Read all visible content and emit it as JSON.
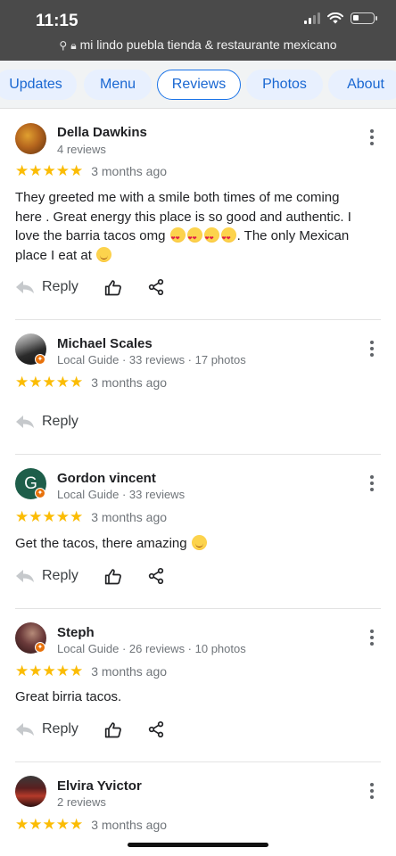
{
  "status_bar": {
    "time": "11:15"
  },
  "url_bar": {
    "text": "mi lindo puebla tienda & restaurante mexicano"
  },
  "tabs": [
    {
      "label": "Updates",
      "active": false
    },
    {
      "label": "Menu",
      "active": false
    },
    {
      "label": "Reviews",
      "active": true
    },
    {
      "label": "Photos",
      "active": false
    },
    {
      "label": "About",
      "active": false
    }
  ],
  "reviews": [
    {
      "name": "Della Dawkins",
      "meta": "4 reviews",
      "rating": 5,
      "stars": "★★★★★",
      "time_ago": "3 months ago",
      "text_lines": [
        "They greeted me with a smile both times of me coming",
        "here . Great energy this place is so good and authentic. I",
        "love the barria tacos omg",
        ". The only Mexican",
        "place I eat at"
      ],
      "actions": {
        "reply": "Reply",
        "like": true,
        "share": true
      }
    },
    {
      "name": "Michael Scales",
      "meta": "Local Guide · 33 reviews · 17 photos",
      "rating": 5,
      "stars": "★★★★★",
      "time_ago": "3 months ago",
      "actions": {
        "reply": "Reply",
        "like": false,
        "share": false
      }
    },
    {
      "name": "Gordon vincent",
      "initial": "G",
      "meta": "Local Guide · 33 reviews",
      "rating": 5,
      "stars": "★★★★★",
      "time_ago": "3 months ago",
      "text": "Get the tacos, there amazing",
      "actions": {
        "reply": "Reply",
        "like": true,
        "share": true
      }
    },
    {
      "name": "Steph",
      "meta": "Local Guide · 26 reviews · 10 photos",
      "rating": 5,
      "stars": "★★★★★",
      "time_ago": "3 months ago",
      "text": "Great birria tacos.",
      "actions": {
        "reply": "Reply",
        "like": true,
        "share": true
      }
    },
    {
      "name": "Elvira Yvictor",
      "meta": "2 reviews",
      "rating": 5,
      "stars": "★★★★★",
      "time_ago": "3 months ago"
    }
  ],
  "colors": {
    "accent": "#1a73e8",
    "star": "#fbbc04",
    "badge": "#e8710a",
    "gordon_avatar": "#1e5e4a"
  }
}
